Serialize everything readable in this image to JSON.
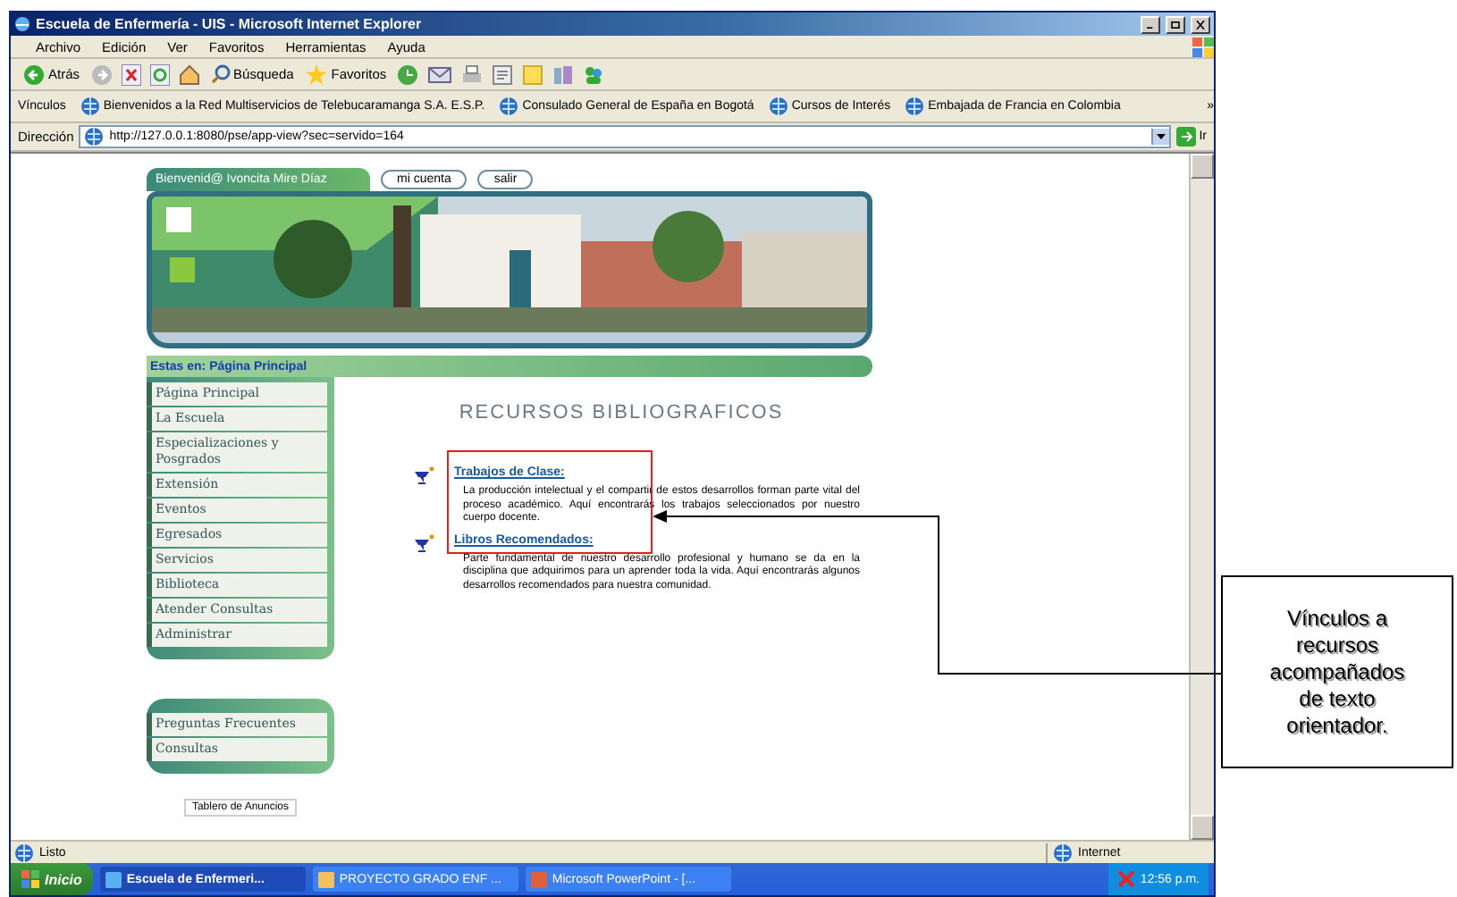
{
  "window": {
    "title": "Escuela de Enfermería - UIS - Microsoft Internet Explorer"
  },
  "menu_bar": [
    "Archivo",
    "Edición",
    "Ver",
    "Favoritos",
    "Herramientas",
    "Ayuda"
  ],
  "toolbar": {
    "back": "Atrás",
    "search": "Búsqueda",
    "favorites": "Favoritos"
  },
  "links_bar": {
    "label": "Vínculos",
    "links": [
      "Bienvenidos a la Red Multiservicios de Telebucaramanga S.A. E.S.P.",
      "Consulado General de España en Bogotá",
      "Cursos de Interés",
      "Embajada de Francia en Colombia"
    ],
    "more": "»"
  },
  "address_bar": {
    "label": "Dirección",
    "url": "http://127.0.0.1:8080/pse/app-view?sec=servido=164",
    "go": "Ir"
  },
  "site": {
    "greeting": "Bienvenid@ Ivoncita Mire Díaz",
    "header_buttons": [
      "mi cuenta",
      "salir"
    ],
    "breadcrumb": "Estas en: Página Principal",
    "menu": [
      "Página Principal",
      "La Escuela",
      "Especializaciones y Posgrados",
      "Extensión",
      "Eventos",
      "Egresados",
      "Servicios",
      "Biblioteca",
      "Atender Consultas",
      "Administrar"
    ],
    "menu_2": [
      "Preguntas Frecuentes",
      "Consultas"
    ],
    "board_link": "Tablero de Anuncios",
    "heading": "RECURSOS BIBLIOGRAFICOS",
    "resources": [
      {
        "title": "Trabajos de Clase:",
        "text": "La producción intelectual y el compartir de estos desarrollos forman parte vital del proceso académico. Aquí encontrarás los trabajos seleccionados por nuestro cuerpo docente."
      },
      {
        "title": "Libros Recomendados:",
        "text": "Parte fundamental de nuestro desarrollo profesional y humano se da en la disciplina que adquirimos para un aprender toda la vida. Aquí encontrarás algunos desarrollos recomendados para nuestra comunidad."
      }
    ]
  },
  "status_bar": {
    "text": "Listo",
    "zone": "Internet"
  },
  "taskbar": {
    "start": "Inicio",
    "tasks": [
      {
        "label": "Escuela de Enfermeri...",
        "selected": true
      },
      {
        "label": "PROYECTO GRADO ENF ...",
        "selected": false
      },
      {
        "label": "Microsoft PowerPoint - [...",
        "selected": false
      }
    ],
    "clock": "12:56 p.m."
  },
  "callout": "Vínculos a recursos acompañados de texto orientador."
}
